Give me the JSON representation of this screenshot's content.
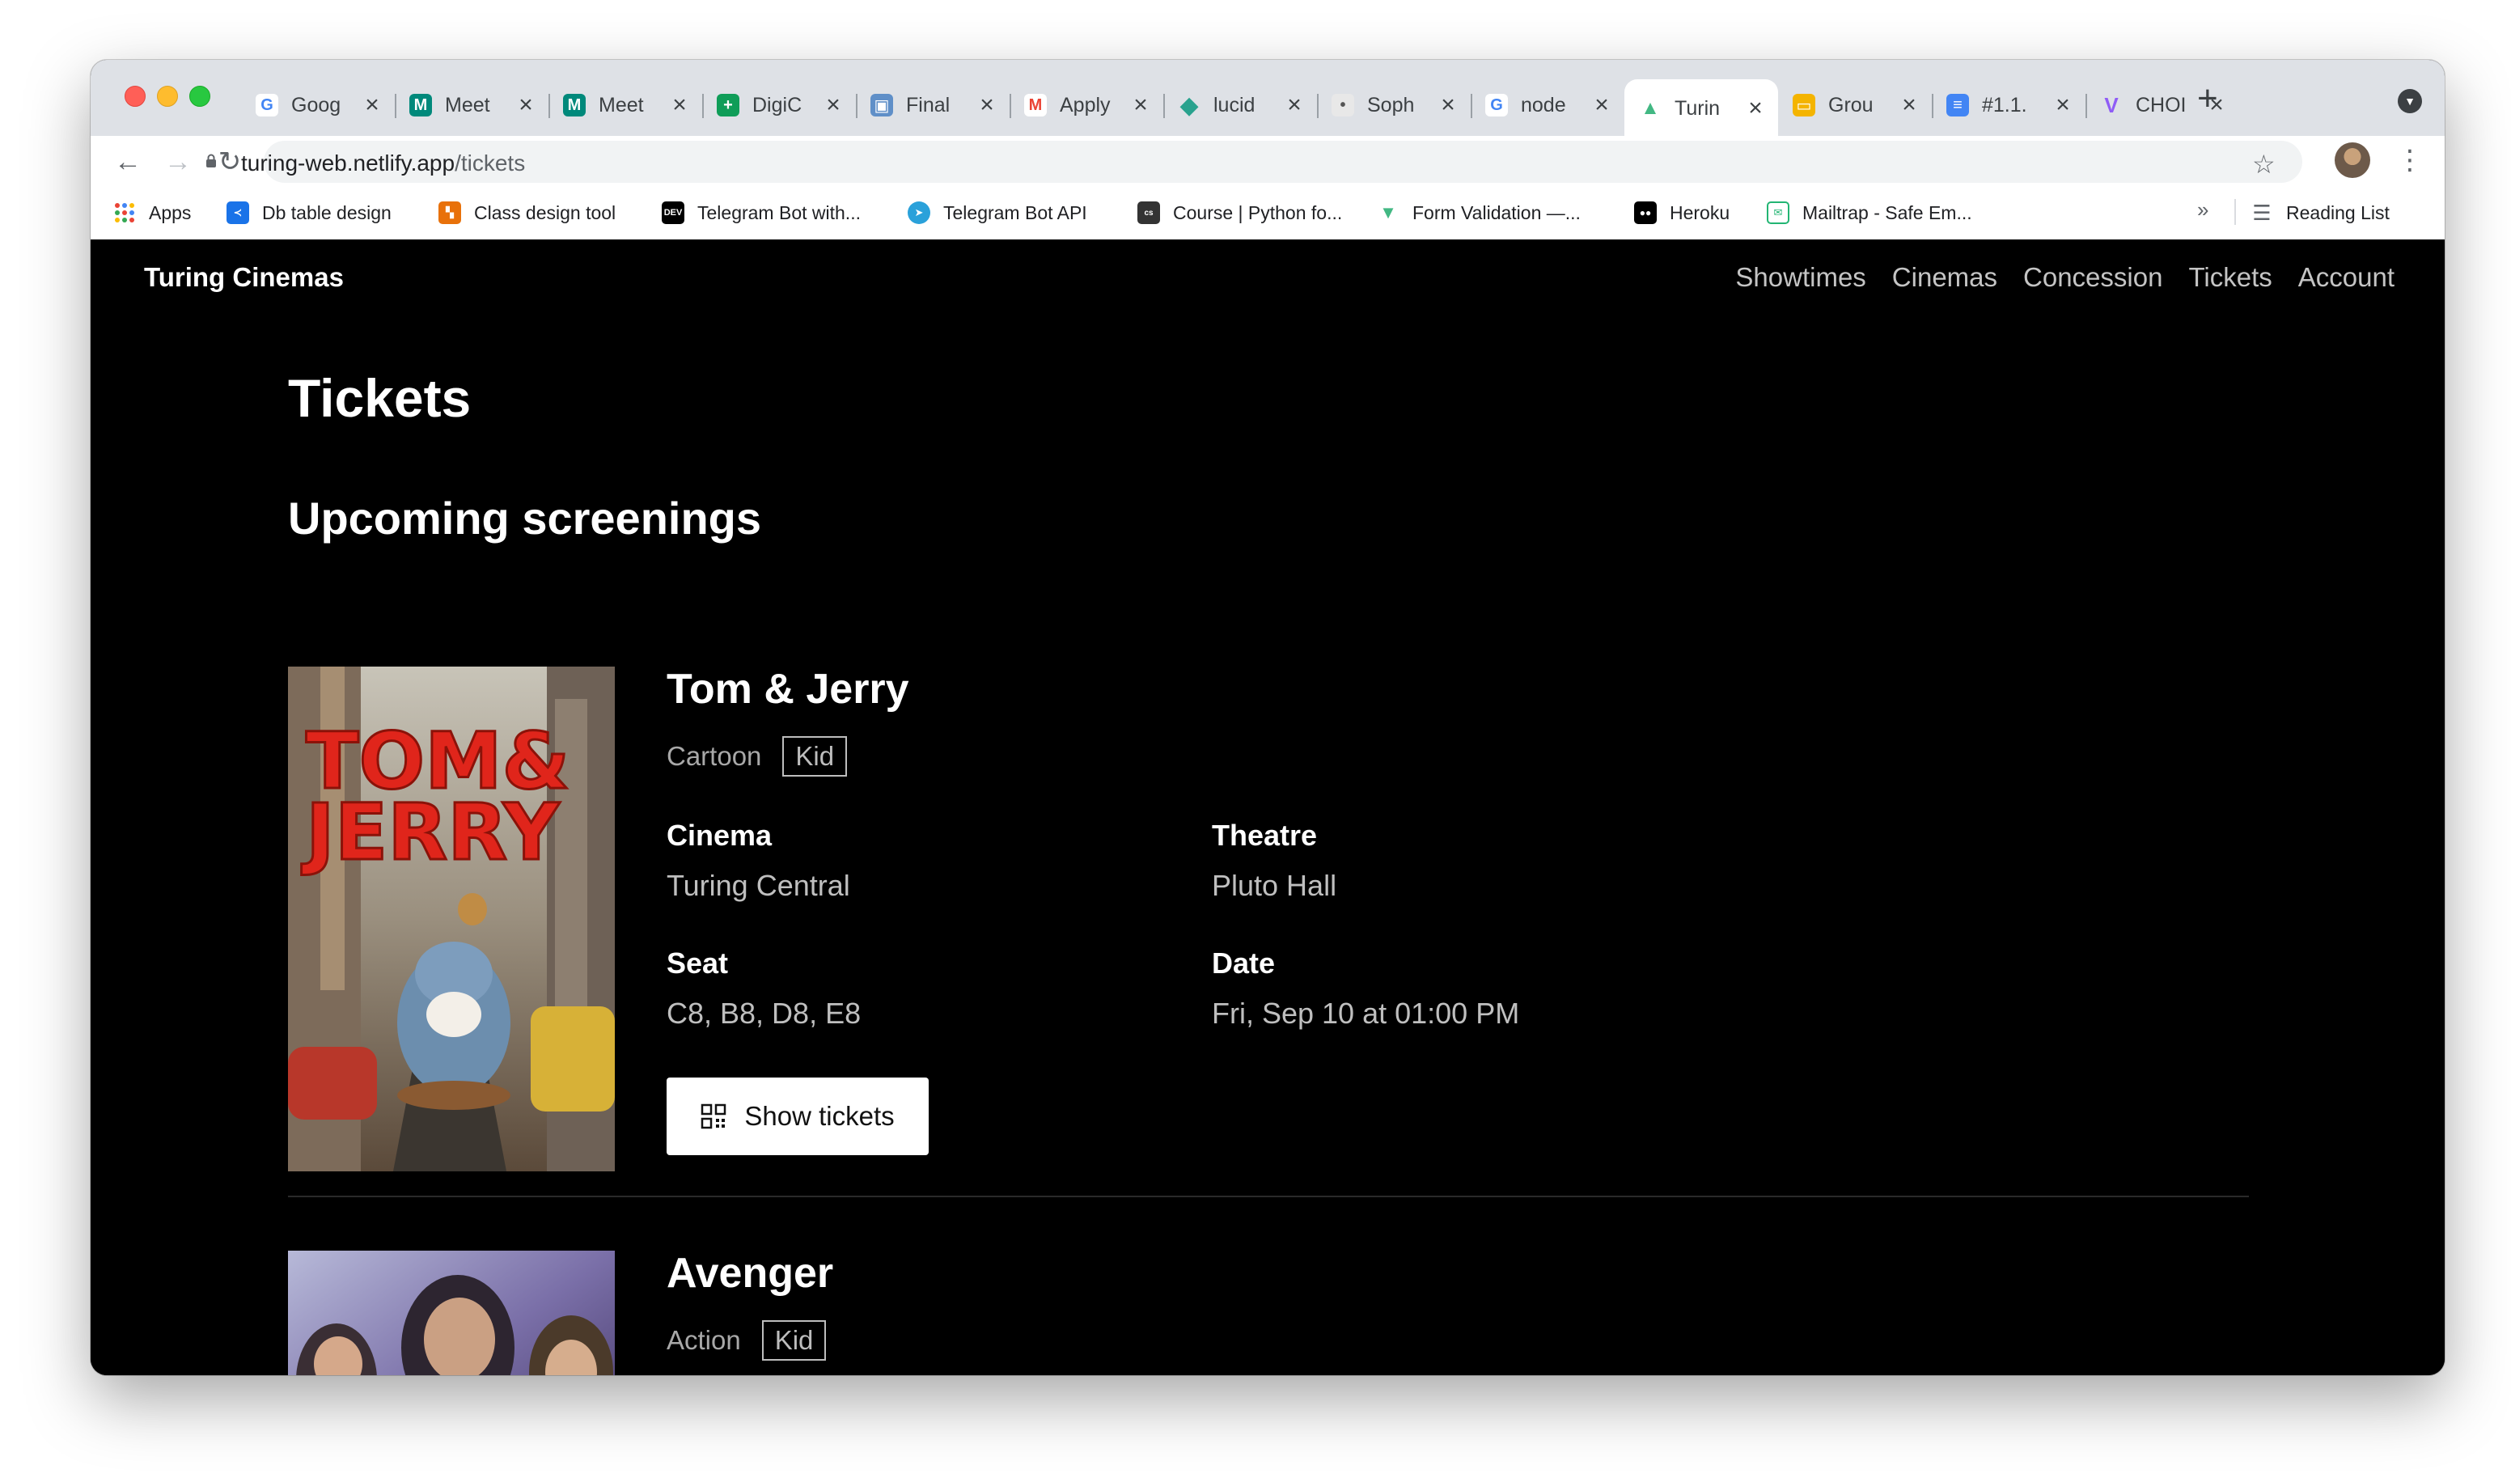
{
  "browser": {
    "tabs": [
      {
        "title": "Goog",
        "fav": "G",
        "fav_color": "#4285f4",
        "icon": "google-icon"
      },
      {
        "title": "Meet",
        "fav": "M",
        "fav_color": "#00897b",
        "icon": "meet-icon"
      },
      {
        "title": "Meet",
        "fav": "M",
        "fav_color": "#00897b",
        "icon": "meet-icon"
      },
      {
        "title": "DigiC",
        "fav": "+",
        "fav_color": "#0f9d58",
        "icon": "sheets-icon"
      },
      {
        "title": "Final",
        "fav": "▣",
        "fav_color": "#5f8fc8",
        "icon": "classroom-icon"
      },
      {
        "title": "Apply",
        "fav": "M",
        "fav_color": "#ea4335",
        "icon": "gmail-icon"
      },
      {
        "title": "lucid",
        "fav": "◆",
        "fav_color": "#29a28e",
        "icon": "lucid-icon"
      },
      {
        "title": "Soph",
        "fav": "•",
        "fav_color": "#8a8a8a",
        "icon": "profile-icon"
      },
      {
        "title": "node",
        "fav": "G",
        "fav_color": "#4285f4",
        "icon": "google-icon"
      },
      {
        "title": "Turin",
        "fav": "▲",
        "fav_color": "#42b883",
        "icon": "vue-icon"
      },
      {
        "title": "Grou",
        "fav": "▭",
        "fav_color": "#f4b400",
        "icon": "slides-icon"
      },
      {
        "title": "#1.1.",
        "fav": "≡",
        "fav_color": "#4285f4",
        "icon": "docs-icon"
      },
      {
        "title": "CHOI",
        "fav": "V",
        "fav_color": "#8f5cf6",
        "icon": "vite-icon"
      }
    ],
    "url_host": "turing-web.netlify.app",
    "url_path": "/tickets",
    "bookmarks": [
      {
        "label": "Apps",
        "icon": "apps-grid-icon",
        "color": "#ea4335"
      },
      {
        "label": "Db table design",
        "icon": "dbdesign-icon",
        "color": "#1a73e8"
      },
      {
        "label": "Class design tool",
        "icon": "classdesign-icon",
        "color": "#e8710a"
      },
      {
        "label": "Telegram Bot with...",
        "icon": "dev-icon",
        "color": "#000000"
      },
      {
        "label": "Telegram Bot API",
        "icon": "telegram-icon",
        "color": "#2aa1da"
      },
      {
        "label": "Course | Python fo...",
        "icon": "course-icon",
        "color": "#333333"
      },
      {
        "label": "Form Validation —...",
        "icon": "vue-icon",
        "color": "#42b883"
      },
      {
        "label": "Heroku",
        "icon": "medium-icon",
        "color": "#000000"
      },
      {
        "label": "Mailtrap - Safe Em...",
        "icon": "mailtrap-icon",
        "color": "#22b573"
      }
    ],
    "reading_list": "Reading List"
  },
  "site": {
    "brand": "Turing Cinemas",
    "nav": [
      "Showtimes",
      "Cinemas",
      "Concession",
      "Tickets",
      "Account"
    ]
  },
  "main": {
    "title": "Tickets",
    "section": "Upcoming screenings",
    "labels": {
      "cinema": "Cinema",
      "theatre": "Theatre",
      "seat": "Seat",
      "date": "Date"
    },
    "tickets": [
      {
        "movie": "Tom & Jerry",
        "genre": "Cartoon",
        "rating": "Kid",
        "cinema": "Turing Central",
        "theatre": "Pluto Hall",
        "seat": "C8, B8, D8, E8",
        "date": "Fri, Sep 10 at 01:00 PM",
        "button": "Show tickets",
        "poster_text_1": "TOM&",
        "poster_text_2": "JERRY"
      },
      {
        "movie": "Avenger",
        "genre": "Action",
        "rating": "Kid"
      }
    ]
  }
}
